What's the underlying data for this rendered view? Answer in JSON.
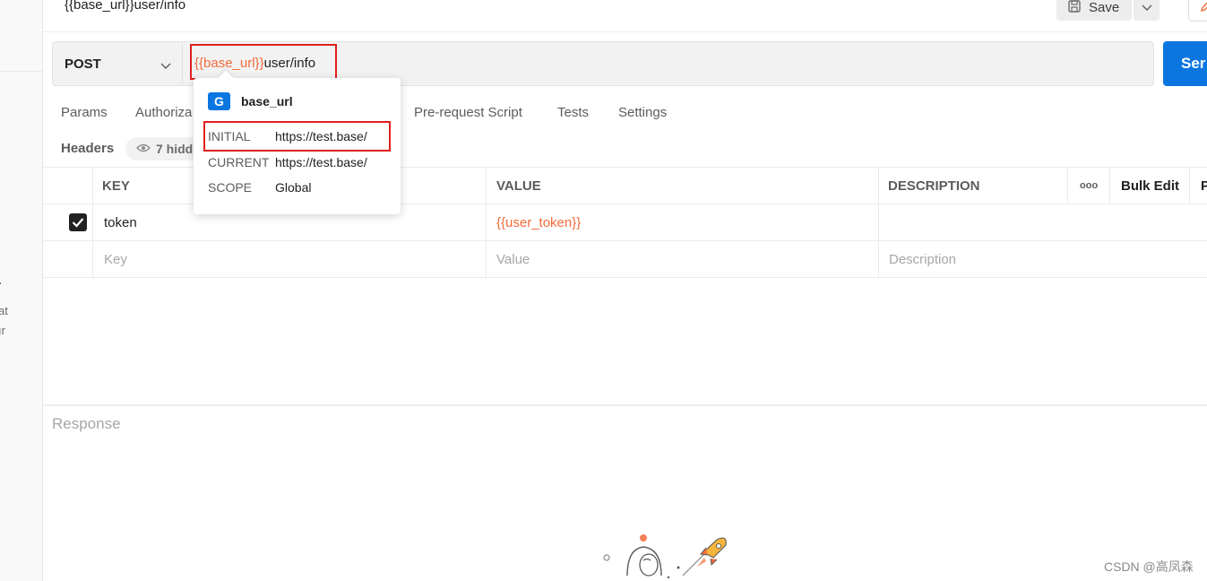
{
  "left_strip": {
    "fragments": [
      ".",
      "at",
      "ır"
    ]
  },
  "header": {
    "title": "{{base_url}}user/info",
    "save_label": "Save"
  },
  "request": {
    "method": "POST",
    "url_variable": "{{base_url}}",
    "url_path": "user/info",
    "send_label": "Ser"
  },
  "tabs": [
    {
      "label": "Params"
    },
    {
      "label": "Authoriza"
    },
    {
      "label": "Pre-request Script"
    },
    {
      "label": "Tests"
    },
    {
      "label": "Settings"
    }
  ],
  "headers_section": {
    "label": "Headers",
    "hidden_label": "7 hidd"
  },
  "table": {
    "columns": [
      "KEY",
      "VALUE",
      "DESCRIPTION"
    ],
    "more_label": "ooo",
    "bulk_edit_label": "Bulk Edit",
    "overflow_label": "P",
    "rows": [
      {
        "checked": true,
        "key": "token",
        "value": "{{user_token}}",
        "description": ""
      }
    ],
    "placeholders": {
      "key": "Key",
      "value": "Value",
      "description": "Description"
    }
  },
  "variable_popover": {
    "badge": "G",
    "name": "base_url",
    "rows": [
      {
        "key": "INITIAL",
        "value": "https://test.base/"
      },
      {
        "key": "CURRENT",
        "value": "https://test.base/"
      },
      {
        "key": "SCOPE",
        "value": "Global"
      }
    ]
  },
  "response": {
    "label": "Response"
  },
  "watermark": "CSDN @高凤森",
  "colors": {
    "accent": "#0b75e0",
    "variable": "#f26b3a",
    "highlight": "#e0201d"
  }
}
